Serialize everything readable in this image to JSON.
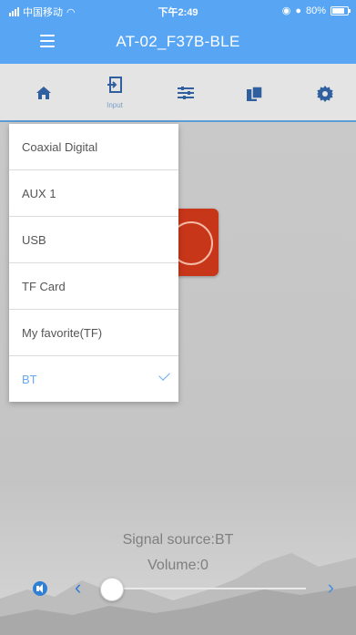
{
  "status": {
    "carrier": "中国移动",
    "time": "下午2:49",
    "battery": "80%",
    "battery_level": 0.8
  },
  "header": {
    "title": "AT-02_F37B-BLE"
  },
  "toolbar": {
    "items": [
      {
        "icon": "home-icon",
        "label": ""
      },
      {
        "icon": "input-icon",
        "label": "Input"
      },
      {
        "icon": "equalizer-icon",
        "label": ""
      },
      {
        "icon": "copy-icon",
        "label": ""
      },
      {
        "icon": "settings-icon",
        "label": ""
      }
    ],
    "accent": "#5c9cd7"
  },
  "dropdown": {
    "items": [
      {
        "label": "Coaxial Digital",
        "selected": false
      },
      {
        "label": "AUX 1",
        "selected": false
      },
      {
        "label": "USB",
        "selected": false
      },
      {
        "label": "TF Card",
        "selected": false
      },
      {
        "label": "My favorite(TF)",
        "selected": false
      },
      {
        "label": "BT",
        "selected": true
      }
    ],
    "selected_color": "#6aa9f0"
  },
  "player": {
    "signal_source": "Signal source:BT",
    "volume_text": "Volume:0",
    "volume_value": 0
  },
  "colors": {
    "brand": "#58a6f3",
    "control_blue": "#2f7fd6",
    "logo_red": "#c8361a"
  }
}
